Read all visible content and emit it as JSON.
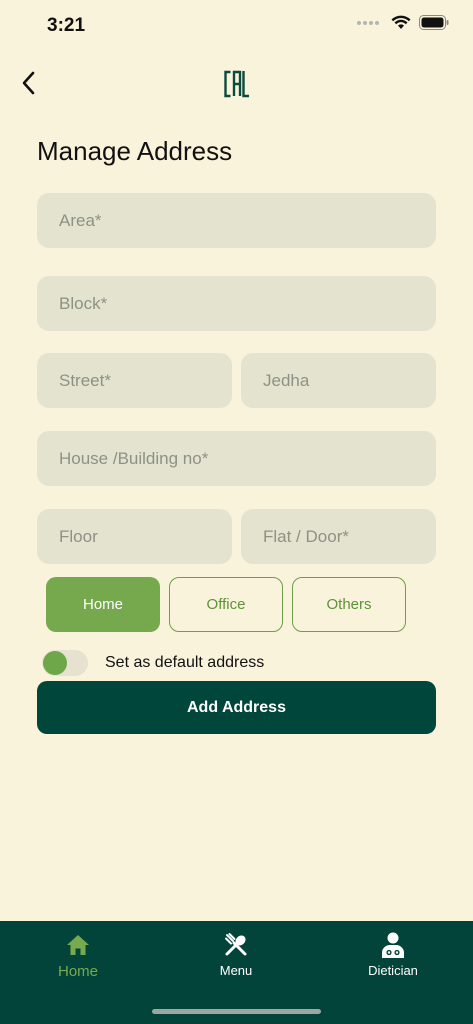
{
  "status_bar": {
    "time": "3:21"
  },
  "header": {
    "logo_text": "CAL"
  },
  "page": {
    "title": "Manage Address"
  },
  "form": {
    "area": {
      "placeholder": "Area*",
      "value": ""
    },
    "block": {
      "placeholder": "Block*",
      "value": ""
    },
    "street": {
      "placeholder": "Street*",
      "value": ""
    },
    "avenue": {
      "placeholder": "Jedha",
      "value": ""
    },
    "house": {
      "placeholder": "House /Building no*",
      "value": ""
    },
    "floor": {
      "placeholder": "Floor",
      "value": ""
    },
    "flat": {
      "placeholder": "Flat / Door*",
      "value": ""
    }
  },
  "address_types": [
    {
      "label": "Home",
      "selected": true
    },
    {
      "label": "Office",
      "selected": false
    },
    {
      "label": "Others",
      "selected": false
    }
  ],
  "default_toggle": {
    "label": "Set as default address",
    "on": false
  },
  "submit": {
    "label": "Add Address"
  },
  "bottom_nav": [
    {
      "label": "Home",
      "icon": "home-icon",
      "active": true
    },
    {
      "label": "Menu",
      "icon": "fork-spoon-icon",
      "active": false
    },
    {
      "label": "Dietician",
      "icon": "dietician-icon",
      "active": false
    }
  ],
  "colors": {
    "background": "#faf3dc",
    "field": "#e3e3d0",
    "accent_green": "#76a84e",
    "dark_green": "#00463a"
  }
}
